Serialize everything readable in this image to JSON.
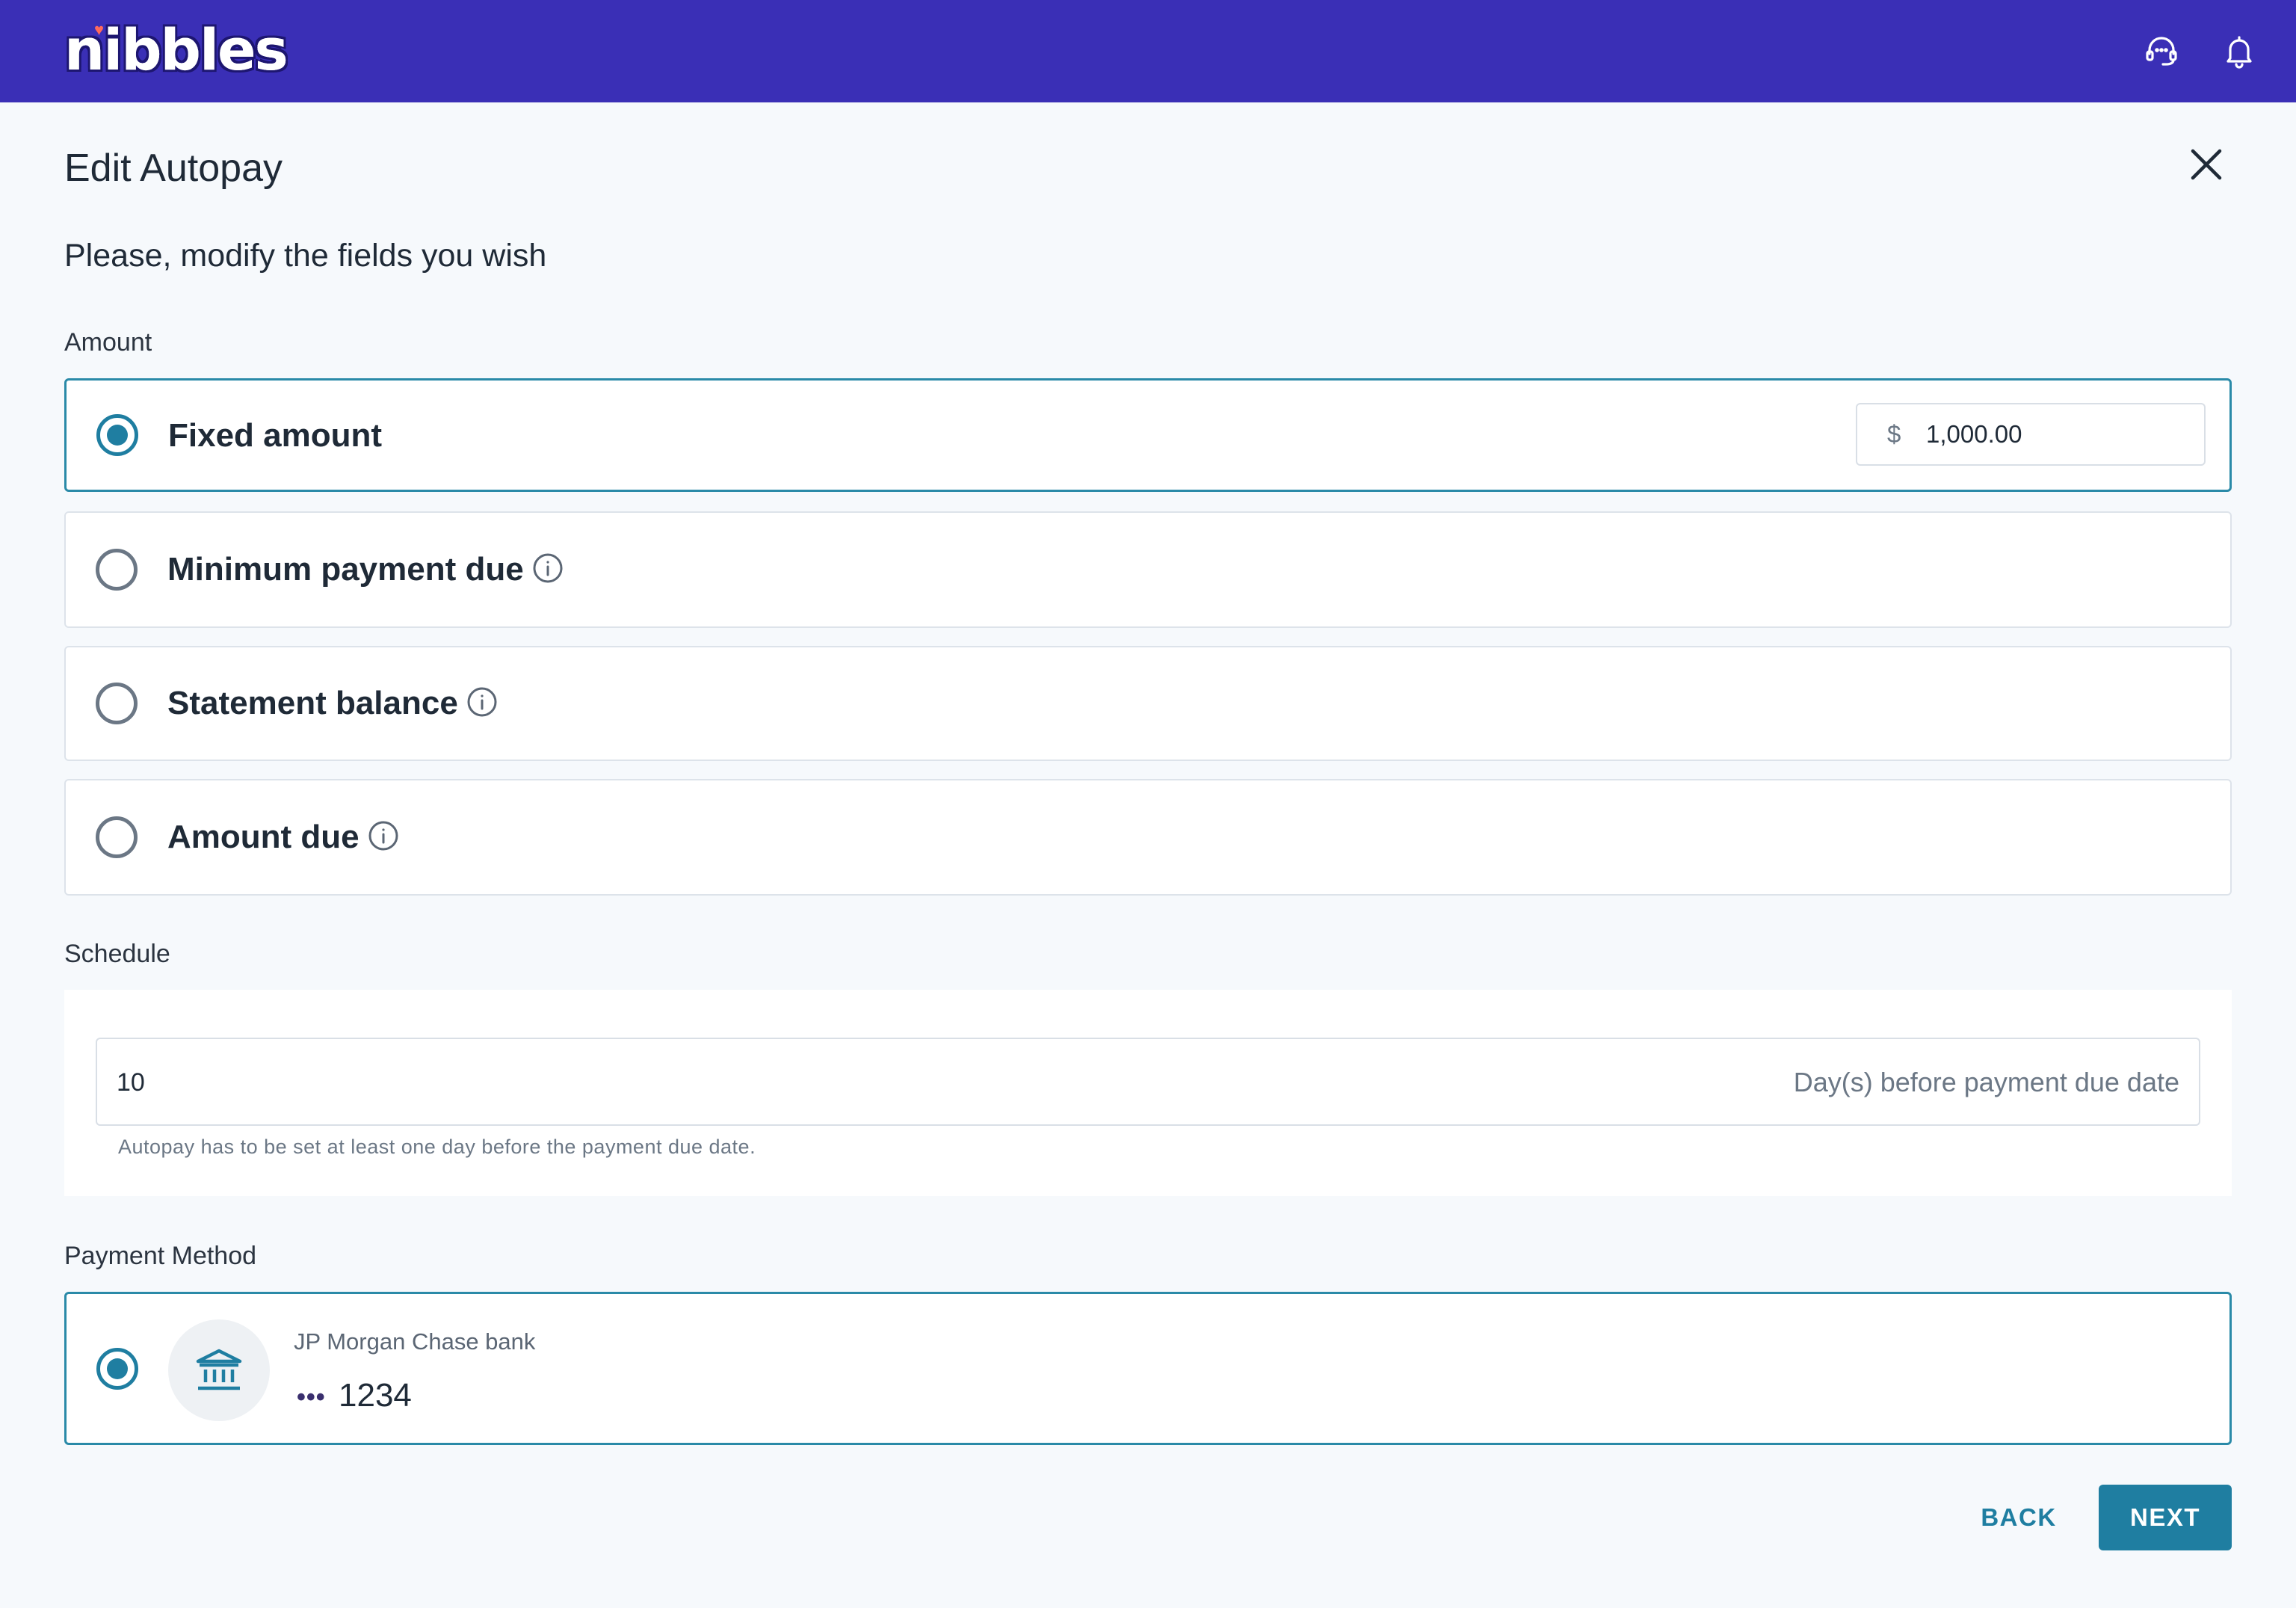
{
  "header": {
    "logo_text": "nibbles",
    "brand_color": "#3a2fb6",
    "icons": [
      "headset-icon",
      "bell-icon"
    ]
  },
  "page": {
    "title": "Edit Autopay",
    "subtitle": "Please, modify the fields you wish"
  },
  "amount": {
    "label": "Amount",
    "options": [
      {
        "label": "Fixed amount",
        "selected": true,
        "currency": "$",
        "value": "1,000.00"
      },
      {
        "label": "Minimum payment due",
        "selected": false,
        "info": true
      },
      {
        "label": "Statement balance",
        "selected": false,
        "info": true
      },
      {
        "label": "Amount due",
        "selected": false,
        "info": true
      }
    ]
  },
  "schedule": {
    "label": "Schedule",
    "value": "10",
    "suffix": "Day(s) before payment due date",
    "helper": "Autopay has to be set at least one day before the payment due date."
  },
  "payment_method": {
    "label": "Payment Method",
    "bank_name": "JP Morgan Chase bank",
    "mask": "•••",
    "last4": "1234",
    "selected": true
  },
  "actions": {
    "back": "BACK",
    "next": "NEXT"
  },
  "colors": {
    "accent": "#1f7ea1",
    "background": "#f6f9fc"
  }
}
